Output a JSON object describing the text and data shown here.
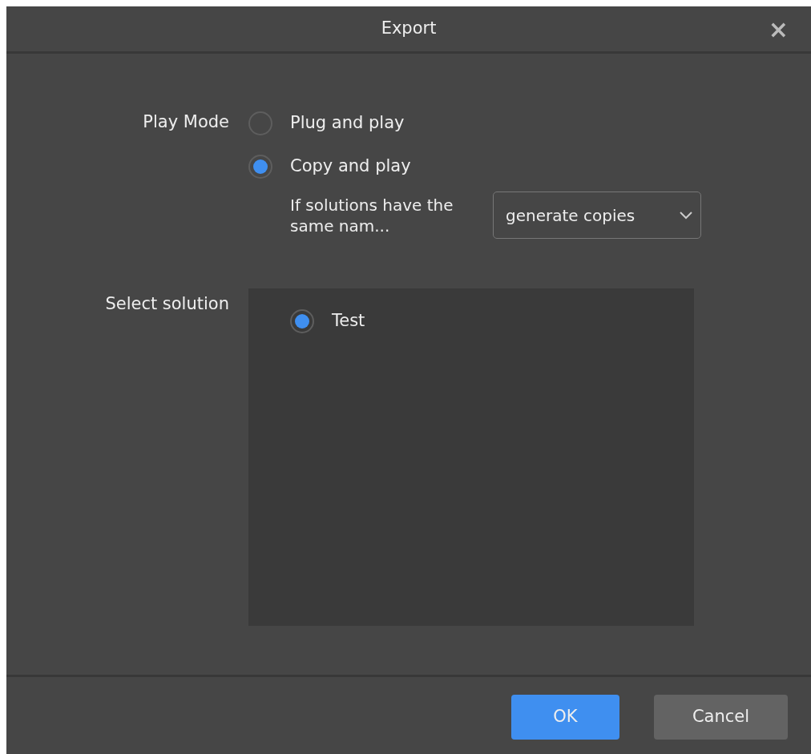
{
  "window": {
    "title": "Export",
    "close": "×"
  },
  "play_mode": {
    "label": "Play Mode",
    "options": [
      {
        "label": "Plug and play",
        "selected": false
      },
      {
        "label": "Copy and play",
        "selected": true
      }
    ],
    "same_name": {
      "label": "If solutions have the same nam...",
      "value": "generate copies"
    }
  },
  "select_solution": {
    "label": "Select solution",
    "items": [
      {
        "label": "Test",
        "selected": true
      }
    ]
  },
  "buttons": [
    {
      "label": "OK",
      "kind": "primary"
    },
    {
      "label": "Cancel",
      "kind": "secondary"
    }
  ]
}
